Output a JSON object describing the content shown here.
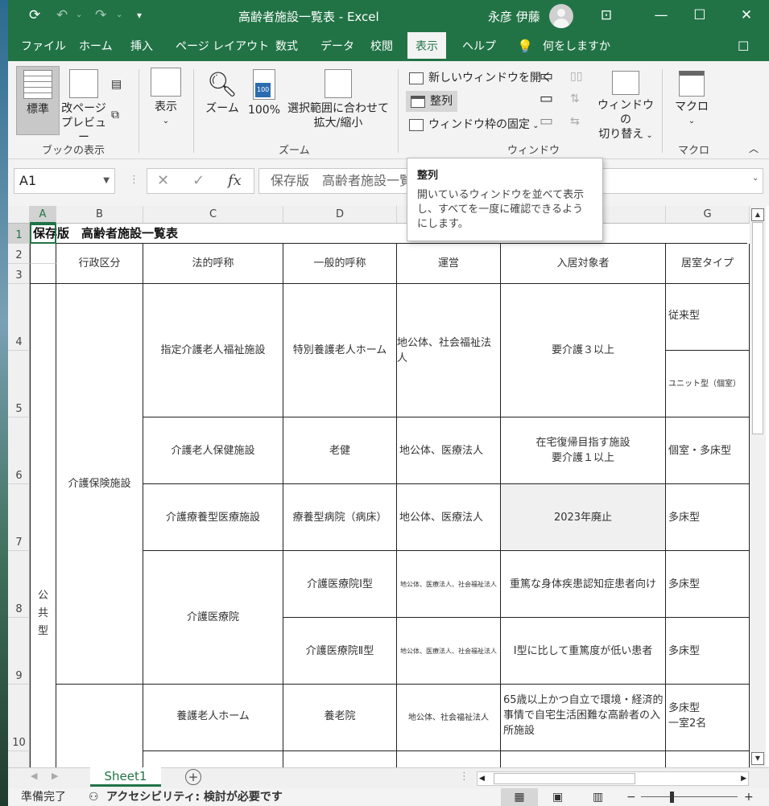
{
  "window": {
    "title": "高齢者施設一覧表 - Excel",
    "user_name": "永彦 伊藤"
  },
  "tabs": [
    "ファイル",
    "ホーム",
    "挿入",
    "ページ レイアウト",
    "数式",
    "データ",
    "校閲",
    "表示",
    "ヘルプ"
  ],
  "active_tab": "表示",
  "tell_me": "何をしますか",
  "ribbon": {
    "view_group": {
      "label": "ブックの表示",
      "normal": "標準",
      "page_break_1": "改ページ",
      "page_break_2": "プレビュー"
    },
    "show": "表示",
    "zoom_group": {
      "label": "ズーム",
      "zoom": "ズーム",
      "zoom100": "100%",
      "fit_1": "選択範囲に合わせて",
      "fit_2": "拡大/縮小"
    },
    "window_group": {
      "label": "ウィンドウ",
      "new_window": "新しいウィンドウを開く",
      "arrange": "整列",
      "freeze": "ウィンドウ枠の固定",
      "switch_1": "ウィンドウの",
      "switch_2": "切り替え"
    },
    "macro_group": {
      "label": "マクロ",
      "macro": "マクロ"
    }
  },
  "formula_bar": {
    "name_box": "A1",
    "fx": "fx",
    "content": "保存版　高齢者施設一覧表"
  },
  "tooltip": {
    "title": "整列",
    "body": "開いているウィンドウを並べて表示し、すべてを一度に確認できるようにします。"
  },
  "columns": [
    "A",
    "B",
    "C",
    "D",
    "E",
    "F",
    "G"
  ],
  "rows": [
    "1",
    "2",
    "3",
    "4",
    "5",
    "6",
    "7",
    "8",
    "9",
    "10"
  ],
  "sheet": {
    "title": "保存版　高齢者施設一覧表",
    "headers": {
      "b": "行政区分",
      "c": "法的呼称",
      "d": "一般的呼称",
      "e": "運営",
      "f": "入居対象者",
      "g": "居室タイプ"
    },
    "a_public": "公\n共\n型",
    "b_kaigo": "介護保険施設",
    "r45": {
      "c": "指定介護老人福祉施設",
      "d": "特別養護老人ホーム",
      "e": "地公体、社会福祉法人",
      "f": "要介護３以上",
      "g4": "従来型",
      "g5": "ユニット型（個室）"
    },
    "r6": {
      "c": "介護老人保健施設",
      "d": "老健",
      "e": "地公体、医療法人",
      "f": "在宅復帰目指す施設\n要介護１以上",
      "g": "個室・多床型"
    },
    "r7": {
      "c": "介護療養型医療施設",
      "d": "療養型病院（病床）",
      "e": "地公体、医療法人",
      "f": "2023年廃止",
      "g": "多床型"
    },
    "r89": {
      "c": "介護医療院",
      "d8": "介護医療院Ⅰ型",
      "e8": "地公体、医療法人、社会福祉法人",
      "f8": "重篤な身体疾患認知症患者向け",
      "g8": "多床型",
      "d9": "介護医療院Ⅱ型",
      "e9": "地公体、医療法人、社会福祉法人",
      "f9": "Ⅰ型に比して重篤度が低い患者",
      "g9": "多床型"
    },
    "r10": {
      "c": "養護老人ホーム",
      "d": "養老院",
      "e": "地公体、社会福祉法人",
      "f": "65歳以上かつ自立で環境・経済的事情で自宅生活困難な高齢者の入所施設",
      "g": "多床型\n一室2名"
    }
  },
  "sheet_tab": "Sheet1",
  "status": {
    "ready": "準備完了",
    "accessibility": "アクセシビリティ: 検討が必要です"
  },
  "colors": {
    "excel_green": "#217346",
    "ribbon_bg": "#f3f3f3"
  }
}
